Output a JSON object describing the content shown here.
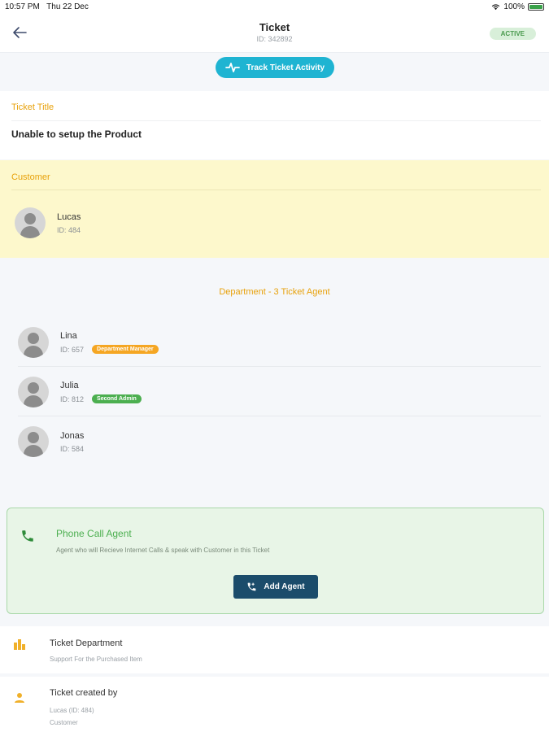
{
  "status_bar": {
    "time": "10:57 PM",
    "date": "Thu 22 Dec",
    "battery": "100%",
    "battery_level": 1.0
  },
  "header": {
    "title": "Ticket",
    "ticket_id": "ID: 342892",
    "status": "ACTIVE"
  },
  "track_button": {
    "label": "Track Ticket Activity"
  },
  "ticket_title": {
    "heading": "Ticket Title",
    "value": "Unable to setup the Product"
  },
  "customer": {
    "heading": "Customer",
    "name": "Lucas",
    "id": "ID: 484"
  },
  "department": {
    "heading": "Department - 3 Ticket Agent",
    "agents": [
      {
        "name": "Lina",
        "id": "ID: 657",
        "badge": "Department Manager",
        "badge_color": "#f5a623"
      },
      {
        "name": "Julia",
        "id": "ID: 812",
        "badge": "Second Admin",
        "badge_color": "#4caf50"
      },
      {
        "name": "Jonas",
        "id": "ID: 584",
        "badge": ""
      }
    ]
  },
  "phone_agent": {
    "title": "Phone Call Agent",
    "description": "Agent who will Recieve Internet Calls & speak with Customer in this Ticket",
    "button": "Add Agent"
  },
  "ticket_department": {
    "label": "Ticket Department",
    "value": "Support For the Purchased Item"
  },
  "created_by": {
    "label": "Ticket created by",
    "value": "Lucas (ID: 484)",
    "role": "Customer"
  },
  "colors": {
    "accent_orange": "#e8a20c",
    "teal": "#1fb4d2",
    "green": "#4caf50",
    "navy": "#1b4c6b"
  }
}
